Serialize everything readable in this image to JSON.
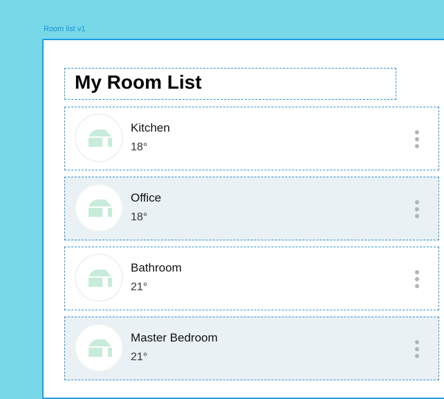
{
  "frame": {
    "label": "Room list v1"
  },
  "header": {
    "title": "My Room List"
  },
  "rooms": [
    {
      "name": "Kitchen",
      "temperature": "18°",
      "icon": "house-icon"
    },
    {
      "name": "Office",
      "temperature": "18°",
      "icon": "house-icon"
    },
    {
      "name": "Bathroom",
      "temperature": "21°",
      "icon": "house-icon"
    },
    {
      "name": "Master Bedroom",
      "temperature": "21°",
      "icon": "house-icon"
    }
  ],
  "colors": {
    "canvas_background": "#77d9e8",
    "frame_border": "#1e9be5",
    "row_alt_background": "#eaf1f4",
    "icon_fill": "#c7ecd9",
    "kebab_dots": "#aeb6bd"
  }
}
